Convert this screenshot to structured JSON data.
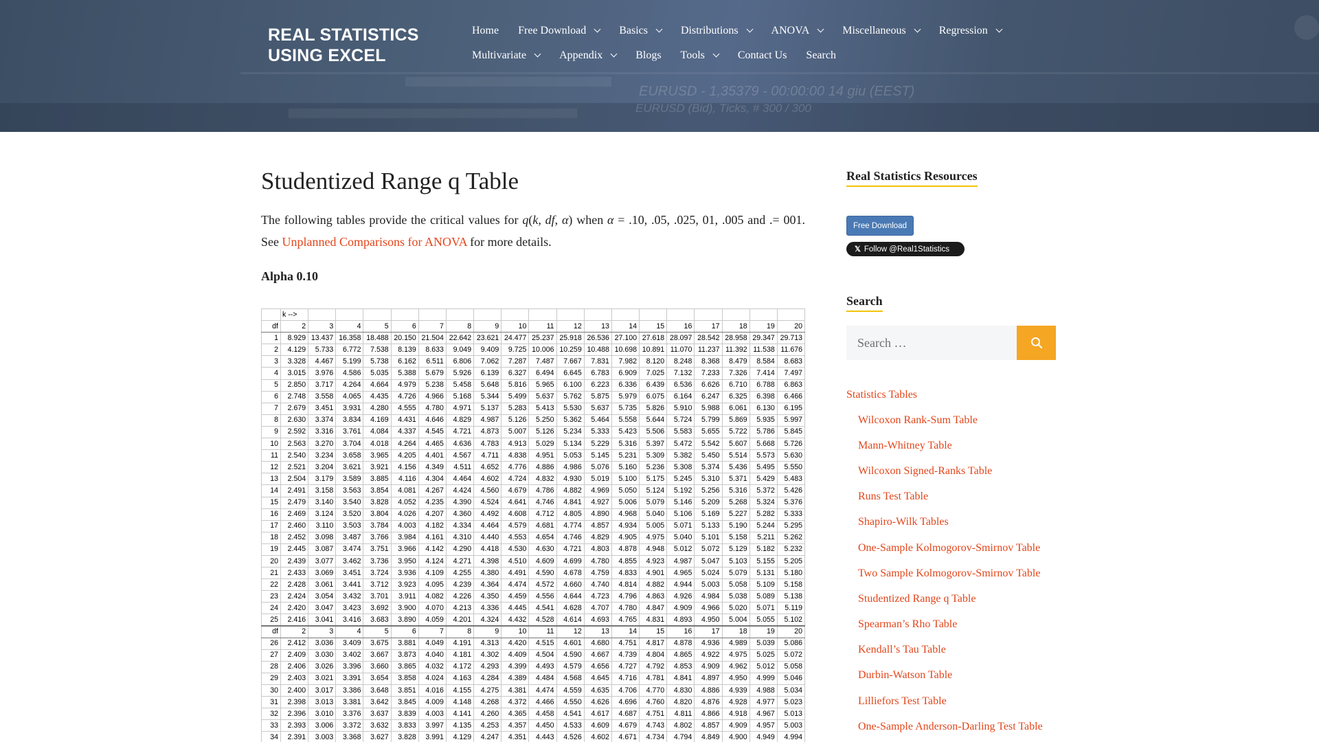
{
  "site": {
    "title_line1": "REAL STATISTICS",
    "title_line2": "USING EXCEL",
    "header_decor": [
      "EURUSD - 1,35379 - 00:00:00 14 giu (EEST)",
      "EURUSD (Bid), Ticks, # 300 / 300"
    ]
  },
  "nav": {
    "row1": [
      {
        "label": "Home",
        "dropdown": false
      },
      {
        "label": "Free Download",
        "dropdown": true
      },
      {
        "label": "Basics",
        "dropdown": true
      },
      {
        "label": "Distributions",
        "dropdown": true
      },
      {
        "label": "ANOVA",
        "dropdown": true
      },
      {
        "label": "Miscellaneous",
        "dropdown": true
      },
      {
        "label": "Regression",
        "dropdown": true
      }
    ],
    "row2": [
      {
        "label": "Multivariate",
        "dropdown": true
      },
      {
        "label": "Appendix",
        "dropdown": true
      },
      {
        "label": "Blogs",
        "dropdown": false
      },
      {
        "label": "Tools",
        "dropdown": true
      },
      {
        "label": "Contact Us",
        "dropdown": false
      },
      {
        "label": "Search",
        "dropdown": false
      }
    ]
  },
  "article": {
    "title": "Studentized Range q Table",
    "intro_1": "The following tables provide the critical values for ",
    "intro_q": "q",
    "intro_paren_open": "(",
    "intro_k": "k",
    "intro_comma1": ", ",
    "intro_df": "df",
    "intro_comma2": ", ",
    "intro_alpha": "α",
    "intro_paren_close": ") when ",
    "intro_alpha2": "α",
    "intro_2": " = .10, .05, .025, 01, .005 and .= 001. See ",
    "intro_link": "Unplanned Comparisons for ANOVA",
    "intro_3": " for more details.",
    "alpha_heading": "Alpha 0.10"
  },
  "qtable": {
    "k_label": "k -->",
    "df_label": "df",
    "k_values": [
      "2",
      "3",
      "4",
      "5",
      "6",
      "7",
      "8",
      "9",
      "10",
      "11",
      "12",
      "13",
      "14",
      "15",
      "16",
      "17",
      "18",
      "19",
      "20"
    ],
    "block1": [
      [
        "1",
        "8.929",
        "13.437",
        "16.358",
        "18.488",
        "20.150",
        "21.504",
        "22.642",
        "23.621",
        "24.477",
        "25.237",
        "25.918",
        "26.536",
        "27.100",
        "27.618",
        "28.097",
        "28.542",
        "28.958",
        "29.347",
        "29.713"
      ],
      [
        "2",
        "4.129",
        "5.733",
        "6.772",
        "7.538",
        "8.139",
        "8.633",
        "9.049",
        "9.409",
        "9.725",
        "10.006",
        "10.259",
        "10.488",
        "10.698",
        "10.891",
        "11.070",
        "11.237",
        "11.392",
        "11.538",
        "11.676"
      ],
      [
        "3",
        "3.328",
        "4.467",
        "5.199",
        "5.738",
        "6.162",
        "6.511",
        "6.806",
        "7.062",
        "7.287",
        "7.487",
        "7.667",
        "7.831",
        "7.982",
        "8.120",
        "8.248",
        "8.368",
        "8.479",
        "8.584",
        "8.683"
      ],
      [
        "4",
        "3.015",
        "3.976",
        "4.586",
        "5.035",
        "5.388",
        "5.679",
        "5.926",
        "6.139",
        "6.327",
        "6.494",
        "6.645",
        "6.783",
        "6.909",
        "7.025",
        "7.132",
        "7.233",
        "7.326",
        "7.414",
        "7.497"
      ],
      [
        "5",
        "2.850",
        "3.717",
        "4.264",
        "4.664",
        "4.979",
        "5.238",
        "5.458",
        "5.648",
        "5.816",
        "5.965",
        "6.100",
        "6.223",
        "6.336",
        "6.439",
        "6.536",
        "6.626",
        "6.710",
        "6.788",
        "6.863"
      ],
      [
        "6",
        "2.748",
        "3.558",
        "4.065",
        "4.435",
        "4.726",
        "4.966",
        "5.168",
        "5.344",
        "5.499",
        "5.637",
        "5.762",
        "5.875",
        "5.979",
        "6.075",
        "6.164",
        "6.247",
        "6.325",
        "6.398",
        "6.466"
      ],
      [
        "7",
        "2.679",
        "3.451",
        "3.931",
        "4.280",
        "4.555",
        "4.780",
        "4.971",
        "5.137",
        "5.283",
        "5.413",
        "5.530",
        "5.637",
        "5.735",
        "5.826",
        "5.910",
        "5.988",
        "6.061",
        "6.130",
        "6.195"
      ],
      [
        "8",
        "2.630",
        "3.374",
        "3.834",
        "4.169",
        "4.431",
        "4.646",
        "4.829",
        "4.987",
        "5.126",
        "5.250",
        "5.362",
        "5.464",
        "5.558",
        "5.644",
        "5.724",
        "5.799",
        "5.869",
        "5.935",
        "5.997"
      ],
      [
        "9",
        "2.592",
        "3.316",
        "3.761",
        "4.084",
        "4.337",
        "4.545",
        "4.721",
        "4.873",
        "5.007",
        "5.126",
        "5.234",
        "5.333",
        "5.423",
        "5.506",
        "5.583",
        "5.655",
        "5.722",
        "5.786",
        "5.845"
      ],
      [
        "10",
        "2.563",
        "3.270",
        "3.704",
        "4.018",
        "4.264",
        "4.465",
        "4.636",
        "4.783",
        "4.913",
        "5.029",
        "5.134",
        "5.229",
        "5.316",
        "5.397",
        "5.472",
        "5.542",
        "5.607",
        "5.668",
        "5.726"
      ],
      [
        "11",
        "2.540",
        "3.234",
        "3.658",
        "3.965",
        "4.205",
        "4.401",
        "4.567",
        "4.711",
        "4.838",
        "4.951",
        "5.053",
        "5.145",
        "5.231",
        "5.309",
        "5.382",
        "5.450",
        "5.514",
        "5.573",
        "5.630"
      ],
      [
        "12",
        "2.521",
        "3.204",
        "3.621",
        "3.921",
        "4.156",
        "4.349",
        "4.511",
        "4.652",
        "4.776",
        "4.886",
        "4.986",
        "5.076",
        "5.160",
        "5.236",
        "5.308",
        "5.374",
        "5.436",
        "5.495",
        "5.550"
      ],
      [
        "13",
        "2.504",
        "3.179",
        "3.589",
        "3.885",
        "4.116",
        "4.304",
        "4.464",
        "4.602",
        "4.724",
        "4.832",
        "4.930",
        "5.019",
        "5.100",
        "5.175",
        "5.245",
        "5.310",
        "5.371",
        "5.429",
        "5.483"
      ],
      [
        "14",
        "2.491",
        "3.158",
        "3.563",
        "3.854",
        "4.081",
        "4.267",
        "4.424",
        "4.560",
        "4.679",
        "4.786",
        "4.882",
        "4.969",
        "5.050",
        "5.124",
        "5.192",
        "5.256",
        "5.316",
        "5.372",
        "5.426"
      ],
      [
        "15",
        "2.479",
        "3.140",
        "3.540",
        "3.828",
        "4.052",
        "4.235",
        "4.390",
        "4.524",
        "4.641",
        "4.746",
        "4.841",
        "4.927",
        "5.006",
        "5.079",
        "5.146",
        "5.209",
        "5.268",
        "5.324",
        "5.376"
      ],
      [
        "16",
        "2.469",
        "3.124",
        "3.520",
        "3.804",
        "4.026",
        "4.207",
        "4.360",
        "4.492",
        "4.608",
        "4.712",
        "4.805",
        "4.890",
        "4.968",
        "5.040",
        "5.106",
        "5.169",
        "5.227",
        "5.282",
        "5.333"
      ],
      [
        "17",
        "2.460",
        "3.110",
        "3.503",
        "3.784",
        "4.003",
        "4.182",
        "4.334",
        "4.464",
        "4.579",
        "4.681",
        "4.774",
        "4.857",
        "4.934",
        "5.005",
        "5.071",
        "5.133",
        "5.190",
        "5.244",
        "5.295"
      ],
      [
        "18",
        "2.452",
        "3.098",
        "3.487",
        "3.766",
        "3.984",
        "4.161",
        "4.310",
        "4.440",
        "4.553",
        "4.654",
        "4.746",
        "4.829",
        "4.905",
        "4.975",
        "5.040",
        "5.101",
        "5.158",
        "5.211",
        "5.262"
      ],
      [
        "19",
        "2.445",
        "3.087",
        "3.474",
        "3.751",
        "3.966",
        "4.142",
        "4.290",
        "4.418",
        "4.530",
        "4.630",
        "4.721",
        "4.803",
        "4.878",
        "4.948",
        "5.012",
        "5.072",
        "5.129",
        "5.182",
        "5.232"
      ],
      [
        "20",
        "2.439",
        "3.077",
        "3.462",
        "3.736",
        "3.950",
        "4.124",
        "4.271",
        "4.398",
        "4.510",
        "4.609",
        "4.699",
        "4.780",
        "4.855",
        "4.923",
        "4.987",
        "5.047",
        "5.103",
        "5.155",
        "5.205"
      ],
      [
        "21",
        "2.433",
        "3.069",
        "3.451",
        "3.724",
        "3.936",
        "4.109",
        "4.255",
        "4.380",
        "4.491",
        "4.590",
        "4.678",
        "4.759",
        "4.833",
        "4.901",
        "4.965",
        "5.024",
        "5.079",
        "5.131",
        "5.180"
      ],
      [
        "22",
        "2.428",
        "3.061",
        "3.441",
        "3.712",
        "3.923",
        "4.095",
        "4.239",
        "4.364",
        "4.474",
        "4.572",
        "4.660",
        "4.740",
        "4.814",
        "4.882",
        "4.944",
        "5.003",
        "5.058",
        "5.109",
        "5.158"
      ],
      [
        "23",
        "2.424",
        "3.054",
        "3.432",
        "3.701",
        "3.911",
        "4.082",
        "4.226",
        "4.350",
        "4.459",
        "4.556",
        "4.644",
        "4.723",
        "4.796",
        "4.863",
        "4.926",
        "4.984",
        "5.038",
        "5.089",
        "5.138"
      ],
      [
        "24",
        "2.420",
        "3.047",
        "3.423",
        "3.692",
        "3.900",
        "4.070",
        "4.213",
        "4.336",
        "4.445",
        "4.541",
        "4.628",
        "4.707",
        "4.780",
        "4.847",
        "4.909",
        "4.966",
        "5.020",
        "5.071",
        "5.119"
      ],
      [
        "25",
        "2.416",
        "3.041",
        "3.416",
        "3.683",
        "3.890",
        "4.059",
        "4.201",
        "4.324",
        "4.432",
        "4.528",
        "4.614",
        "4.693",
        "4.765",
        "4.831",
        "4.893",
        "4.950",
        "5.004",
        "5.055",
        "5.102"
      ]
    ],
    "block2": [
      [
        "26",
        "2.412",
        "3.036",
        "3.409",
        "3.675",
        "3.881",
        "4.049",
        "4.191",
        "4.313",
        "4.420",
        "4.515",
        "4.601",
        "4.680",
        "4.751",
        "4.817",
        "4.878",
        "4.936",
        "4.989",
        "5.039",
        "5.086"
      ],
      [
        "27",
        "2.409",
        "3.030",
        "3.402",
        "3.667",
        "3.873",
        "4.040",
        "4.181",
        "4.302",
        "4.409",
        "4.504",
        "4.590",
        "4.667",
        "4.739",
        "4.804",
        "4.865",
        "4.922",
        "4.975",
        "5.025",
        "5.072"
      ],
      [
        "28",
        "2.406",
        "3.026",
        "3.396",
        "3.660",
        "3.865",
        "4.032",
        "4.172",
        "4.293",
        "4.399",
        "4.493",
        "4.579",
        "4.656",
        "4.727",
        "4.792",
        "4.853",
        "4.909",
        "4.962",
        "5.012",
        "5.058"
      ],
      [
        "29",
        "2.403",
        "3.021",
        "3.391",
        "3.654",
        "3.858",
        "4.024",
        "4.163",
        "4.284",
        "4.389",
        "4.484",
        "4.568",
        "4.645",
        "4.716",
        "4.781",
        "4.841",
        "4.897",
        "4.950",
        "4.999",
        "5.046"
      ],
      [
        "30",
        "2.400",
        "3.017",
        "3.386",
        "3.648",
        "3.851",
        "4.016",
        "4.155",
        "4.275",
        "4.381",
        "4.474",
        "4.559",
        "4.635",
        "4.706",
        "4.770",
        "4.830",
        "4.886",
        "4.939",
        "4.988",
        "5.034"
      ],
      [
        "31",
        "2.398",
        "3.013",
        "3.381",
        "3.642",
        "3.845",
        "4.009",
        "4.148",
        "4.268",
        "4.372",
        "4.466",
        "4.550",
        "4.626",
        "4.696",
        "4.760",
        "4.820",
        "4.876",
        "4.928",
        "4.977",
        "5.023"
      ],
      [
        "32",
        "2.396",
        "3.010",
        "3.376",
        "3.637",
        "3.839",
        "4.003",
        "4.141",
        "4.260",
        "4.365",
        "4.458",
        "4.541",
        "4.617",
        "4.687",
        "4.751",
        "4.811",
        "4.866",
        "4.918",
        "4.967",
        "5.013"
      ],
      [
        "33",
        "2.393",
        "3.006",
        "3.372",
        "3.632",
        "3.833",
        "3.997",
        "4.135",
        "4.253",
        "4.357",
        "4.450",
        "4.533",
        "4.609",
        "4.679",
        "4.743",
        "4.802",
        "4.857",
        "4.909",
        "4.957",
        "5.003"
      ],
      [
        "34",
        "2.391",
        "3.003",
        "3.368",
        "3.627",
        "3.828",
        "3.991",
        "4.129",
        "4.247",
        "4.351",
        "4.443",
        "4.526",
        "4.602",
        "4.671",
        "4.734",
        "4.794",
        "4.849",
        "4.900",
        "4.949",
        "4.994"
      ]
    ]
  },
  "sidebar": {
    "resources_title": "Real Statistics Resources",
    "free_download_label": "Free Download",
    "follow_label": "Follow @Real1Statistics",
    "search_title": "Search",
    "search_placeholder": "Search …",
    "stats_tables_label": "Statistics Tables",
    "links": [
      "Wilcoxon Rank-Sum Table",
      "Mann-Whitney Table",
      "Wilcoxon Signed-Ranks Table",
      "Runs Test Table",
      "Shapiro-Wilk Tables",
      "One-Sample Kolmogorov-Smirnov Table",
      "Two Sample Kolmogorov-Smirnov Table",
      "Studentized Range q Table",
      "Spearman’s Rho Table",
      "Kendall’s Tau Table",
      "Durbin-Watson Table",
      "Lilliefors Test Table",
      "One-Sample Anderson-Darling Test Table"
    ]
  },
  "colors": {
    "header_bg": "#4a5d76",
    "link": "#e2461b",
    "accent": "#f5a623",
    "underline": "#f1c40f",
    "download_button": "#4a7ab5"
  }
}
